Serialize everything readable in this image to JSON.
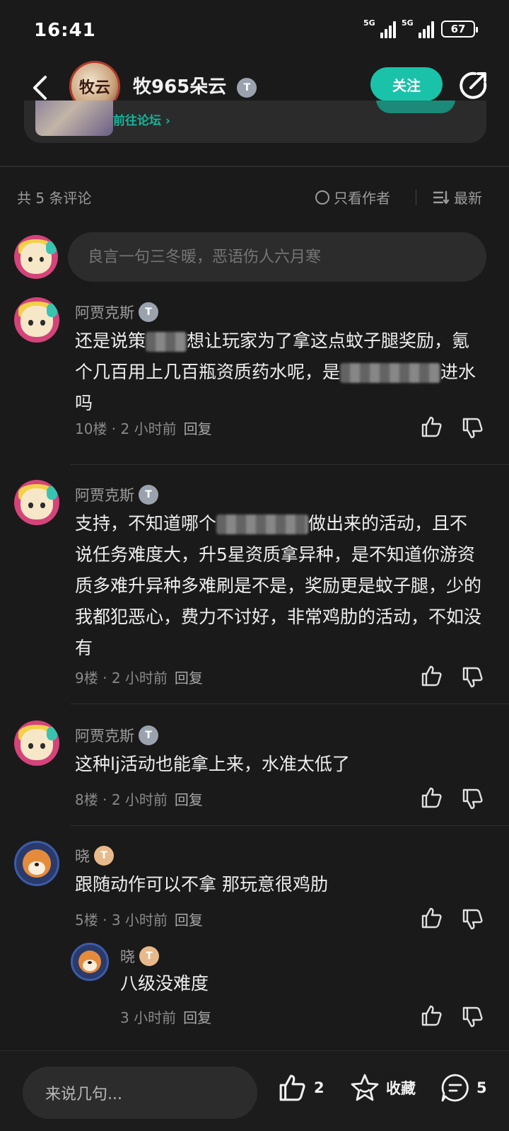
{
  "status_bar": {
    "time": "16:41",
    "network1": "5G",
    "network2": "5G",
    "battery": "67"
  },
  "header": {
    "title": "牧965朵云",
    "level_badge": "T",
    "follow_label": "关注",
    "avatar_text": "牧云"
  },
  "forum_card": {
    "link_label": "前往论坛 ›"
  },
  "comments_bar": {
    "count_label": "共 5 条评论",
    "author_only_label": "只看作者",
    "sort_label": "最新"
  },
  "comment_input": {
    "placeholder": "良言一句三冬暖，恶语伤人六月寒"
  },
  "comments": [
    {
      "user": "阿贾克斯",
      "level": "T",
      "text_parts": [
        "还是说策",
        "想让玩家为了拿这点蚊子腿奖励，氪个几百用上几百瓶资质药水呢，是",
        "进水吗"
      ],
      "floor": "10楼",
      "time": "2 小时前",
      "reply_label": "回复"
    },
    {
      "user": "阿贾克斯",
      "level": "T",
      "text_parts": [
        "支持，不知道哪个",
        "做出来的活动，且不说任务难度大，升5星资质拿异种，是不知道你游资质多难升异种多难刷是不是，奖励更是蚊子腿，少的我都犯恶心，费力不讨好，非常鸡肋的活动，不如没有"
      ],
      "floor": "9楼",
      "time": "2 小时前",
      "reply_label": "回复"
    },
    {
      "user": "阿贾克斯",
      "level": "T",
      "text": "这种lj活动也能拿上来，水准太低了",
      "floor": "8楼",
      "time": "2 小时前",
      "reply_label": "回复"
    },
    {
      "user": "晓",
      "level": "T",
      "text": "跟随动作可以不拿 那玩意很鸡肋",
      "floor": "5楼",
      "time": "3 小时前",
      "reply_label": "回复",
      "reply": {
        "user": "晓",
        "level": "T",
        "text": "八级没难度",
        "time": "3 小时前",
        "reply_label": "回复"
      }
    }
  ],
  "bottom_bar": {
    "input_placeholder": "来说几句...",
    "like_count": "2",
    "favorite_label": "收藏",
    "comment_count": "5"
  },
  "colors": {
    "accent": "#19c2a8",
    "background": "#1a1a1a",
    "input": "#2c2c2c"
  },
  "icons": [
    "back-arrow-icon",
    "share-icon",
    "thumbs-up-icon",
    "thumbs-down-icon",
    "star-icon",
    "comment-icon",
    "sort-icon"
  ]
}
